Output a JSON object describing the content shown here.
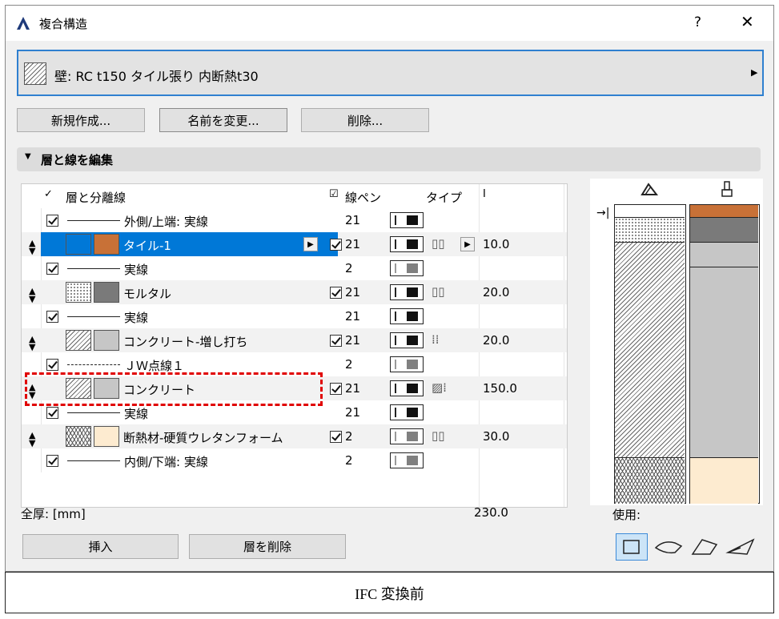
{
  "window": {
    "title": "複合構造",
    "help": "?",
    "close": "✕"
  },
  "composite": {
    "name": "壁: RC t150 タイル張り 内断熱t30"
  },
  "buttons": {
    "new": "新規作成...",
    "rename": "名前を変更...",
    "delete": "削除...",
    "insert": "挿入",
    "delete_layer": "層を削除"
  },
  "section": {
    "title": "層と線を編集"
  },
  "columns": {
    "layers": "層と分離線",
    "pen": "線ペン",
    "type": "タイプ",
    "thickness_icon": "thickness-icon"
  },
  "rows": [
    {
      "kind": "line",
      "label": "外側/上端: 実線",
      "pen": "21",
      "checked": true
    },
    {
      "kind": "layer",
      "label": "タイル-1",
      "pen": "21",
      "thickness": "10.0",
      "selected": true
    },
    {
      "kind": "line",
      "label": "実線",
      "pen": "2",
      "checked": true
    },
    {
      "kind": "layer",
      "label": "モルタル",
      "pen": "21",
      "thickness": "20.0"
    },
    {
      "kind": "line",
      "label": "実線",
      "pen": "21",
      "checked": true
    },
    {
      "kind": "layer",
      "label": "コンクリート-増し打ち",
      "pen": "21",
      "thickness": "20.0"
    },
    {
      "kind": "line",
      "label": "ＪＷ点線１",
      "pen": "2",
      "checked": true
    },
    {
      "kind": "layer",
      "label": "コンクリート",
      "pen": "21",
      "thickness": "150.0"
    },
    {
      "kind": "line",
      "label": "実線",
      "pen": "21",
      "checked": true
    },
    {
      "kind": "layer",
      "label": "断熱材-硬質ウレタンフォーム",
      "pen": "2",
      "thickness": "30.0"
    },
    {
      "kind": "line",
      "label": "内側/下端: 実線",
      "pen": "2",
      "checked": true
    }
  ],
  "total": {
    "label": "全厚: [mm]",
    "value": "230.0"
  },
  "preview": {
    "use_label": "使用:"
  },
  "caption": "IFC 変換前",
  "colors": {
    "tile": "#c87137",
    "selection": "#0078d7",
    "insulation": "#fdebd0",
    "highlight_box": "#e00000"
  }
}
